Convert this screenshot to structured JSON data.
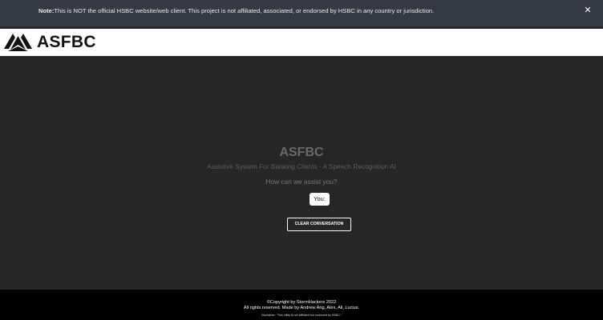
{
  "notice": {
    "label": "Note:",
    "text": "This is NOT the official HSBC website/web client. This project is not affiliated, associated, or endorsed by HSBC in any country or jurisdiction.",
    "close_symbol": "✕"
  },
  "header": {
    "logo_text": "ASFBC",
    "logo_icon": "hexagon-arrows-logo"
  },
  "main": {
    "title": "ASFBC",
    "subtitle": "Assistive System For Banking Clients - A Speech Recognition AI",
    "prompt": "How can we assist you?",
    "you_label": "You:",
    "clear_button": "CLEAR CONVERSATION"
  },
  "footer": {
    "copyright": "©Copyright by StormHackers 2022",
    "rights": "All rights reserved. Made by Andrew Ang, Alex, Ali, Lucius.",
    "disclaimer": "Disclaimer: \"This utility is not affiliated nor endorsed by HSBC.\""
  },
  "colors": {
    "banner_bg": "#333a46",
    "header_bg": "#ffffff",
    "main_bg": "#262626",
    "footer_bg": "#000000"
  }
}
